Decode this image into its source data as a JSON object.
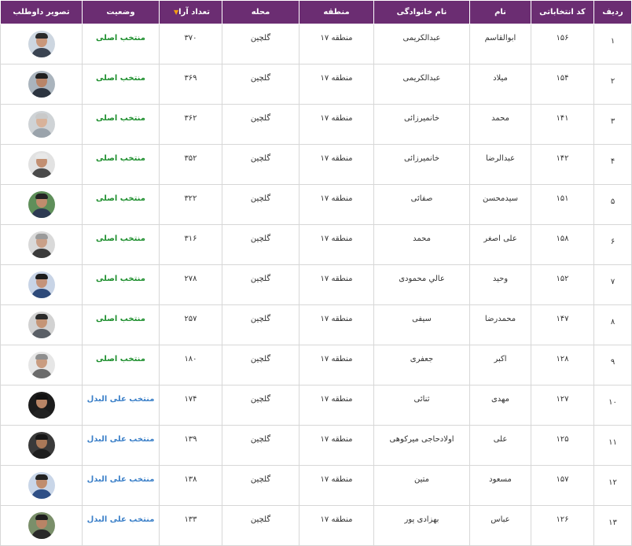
{
  "headers": {
    "row": "ردیف",
    "code": "کد انتخاباتی",
    "first_name": "نام",
    "last_name": "نام خانوادگی",
    "region": "منطقه",
    "neighborhood": "محله",
    "votes": "تعداد آرا",
    "status": "وضعیت",
    "photo": "تصویر داوطلب"
  },
  "sort_indicator": "▼",
  "colors": {
    "header_bg": "#6b2d72",
    "primary_status": "#1e8f2e",
    "alternate_status": "#3a7fc8",
    "sort_arrow": "#f39c12"
  },
  "rows": [
    {
      "row": "۱",
      "code": "۱۵۶",
      "first_name": "ابوالقاسم",
      "last_name": "عبدالکریمی",
      "region": "منطقه ۱۷",
      "neighborhood": "گلچین",
      "votes": "۳۷۰",
      "status": "منتخب اصلی",
      "status_type": "primary",
      "photo": {
        "bg": "#cdd6e0",
        "skin": "#c9977a",
        "hair": "#2a2a2a",
        "shirt": "#3b4452"
      }
    },
    {
      "row": "۲",
      "code": "۱۵۴",
      "first_name": "میلاد",
      "last_name": "عبدالکریمی",
      "region": "منطقه ۱۷",
      "neighborhood": "گلچین",
      "votes": "۳۶۹",
      "status": "منتخب اصلی",
      "status_type": "primary",
      "photo": {
        "bg": "#aab4bd",
        "skin": "#b98568",
        "hair": "#1f1f1f",
        "shirt": "#2c3440"
      }
    },
    {
      "row": "۳",
      "code": "۱۴۱",
      "first_name": "محمد",
      "last_name": "خانمیرزائی",
      "region": "منطقه ۱۷",
      "neighborhood": "گلچین",
      "votes": "۳۶۲",
      "status": "منتخب اصلی",
      "status_type": "primary",
      "photo": {
        "bg": "#cfd3d6",
        "skin": "#d8b29a",
        "hair": "#c9c9c9",
        "shirt": "#9aa3ab"
      }
    },
    {
      "row": "۴",
      "code": "۱۴۲",
      "first_name": "عبدالرضا",
      "last_name": "خانمیرزائی",
      "region": "منطقه ۱۷",
      "neighborhood": "گلچین",
      "votes": "۳۵۲",
      "status": "منتخب اصلی",
      "status_type": "primary",
      "photo": {
        "bg": "#e2e2e2",
        "skin": "#c28f72",
        "hair": "#e8e8e8",
        "shirt": "#4a4a4a"
      }
    },
    {
      "row": "۵",
      "code": "۱۵۱",
      "first_name": "سیدمحسن",
      "last_name": "صفائی",
      "region": "منطقه ۱۷",
      "neighborhood": "گلچین",
      "votes": "۳۲۲",
      "status": "منتخب اصلی",
      "status_type": "primary",
      "photo": {
        "bg": "#5f8f5a",
        "skin": "#c08c6d",
        "hair": "#232323",
        "shirt": "#2d3a52"
      }
    },
    {
      "row": "۶",
      "code": "۱۵۸",
      "first_name": "علی اصغر",
      "last_name": "محمد",
      "region": "منطقه ۱۷",
      "neighborhood": "گلچین",
      "votes": "۳۱۶",
      "status": "منتخب اصلی",
      "status_type": "primary",
      "photo": {
        "bg": "#d9d9d9",
        "skin": "#c9a088",
        "hair": "#9a9a9a",
        "shirt": "#3a3a3a"
      }
    },
    {
      "row": "۷",
      "code": "۱۵۲",
      "first_name": "وحید",
      "last_name": "عالي محمودی",
      "region": "منطقه ۱۷",
      "neighborhood": "گلچین",
      "votes": "۲۷۸",
      "status": "منتخب اصلی",
      "status_type": "primary",
      "photo": {
        "bg": "#c8d4e6",
        "skin": "#c4937a",
        "hair": "#1c1c1c",
        "shirt": "#2e4a7a"
      }
    },
    {
      "row": "۸",
      "code": "۱۴۷",
      "first_name": "محمدرضا",
      "last_name": "سیفی",
      "region": "منطقه ۱۷",
      "neighborhood": "گلچین",
      "votes": "۲۵۷",
      "status": "منتخب اصلی",
      "status_type": "primary",
      "photo": {
        "bg": "#d2d2d2",
        "skin": "#c59576",
        "hair": "#2a2a2a",
        "shirt": "#5a5f66"
      }
    },
    {
      "row": "۹",
      "code": "۱۲۸",
      "first_name": "اکبر",
      "last_name": "جعفری",
      "region": "منطقه ۱۷",
      "neighborhood": "گلچین",
      "votes": "۱۸۰",
      "status": "منتخب اصلی",
      "status_type": "primary",
      "photo": {
        "bg": "#e6e6e6",
        "skin": "#c99c80",
        "hair": "#8e8e8e",
        "shirt": "#6b6b6b"
      }
    },
    {
      "row": "۱۰",
      "code": "۱۲۷",
      "first_name": "مهدی",
      "last_name": "ثنائی",
      "region": "منطقه ۱۷",
      "neighborhood": "گلچین",
      "votes": "۱۷۴",
      "status": "منتخب علی البدل",
      "status_type": "alt",
      "photo": {
        "bg": "#1c1c1c",
        "skin": "#b98566",
        "hair": "#111111",
        "shirt": "#222222"
      }
    },
    {
      "row": "۱۱",
      "code": "۱۲۵",
      "first_name": "علی",
      "last_name": "اولادحاجی میرکوهی",
      "region": "منطقه ۱۷",
      "neighborhood": "گلچین",
      "votes": "۱۳۹",
      "status": "منتخب علی البدل",
      "status_type": "alt",
      "photo": {
        "bg": "#3a3a3a",
        "skin": "#a97858",
        "hair": "#161616",
        "shirt": "#1d1d1d"
      }
    },
    {
      "row": "۱۲",
      "code": "۱۵۷",
      "first_name": "مسعود",
      "last_name": "متین",
      "region": "منطقه ۱۷",
      "neighborhood": "گلچین",
      "votes": "۱۳۸",
      "status": "منتخب علی البدل",
      "status_type": "alt",
      "photo": {
        "bg": "#c9d6e8",
        "skin": "#c08d6e",
        "hair": "#222222",
        "shirt": "#2f4f86"
      }
    },
    {
      "row": "۱۳",
      "code": "۱۲۶",
      "first_name": "عباس",
      "last_name": "بهزادی پور",
      "region": "منطقه ۱۷",
      "neighborhood": "گلچین",
      "votes": "۱۳۳",
      "status": "منتخب علی البدل",
      "status_type": "alt",
      "photo": {
        "bg": "#7a8f6a",
        "skin": "#b88466",
        "hair": "#1e1e1e",
        "shirt": "#2a2a2a"
      }
    }
  ]
}
